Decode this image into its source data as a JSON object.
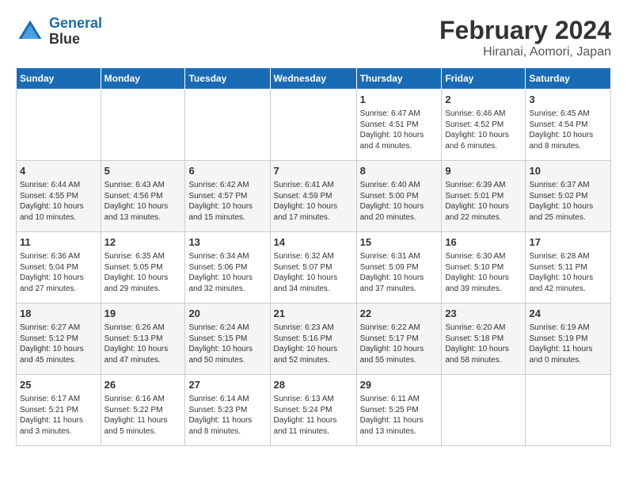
{
  "header": {
    "logo_line1": "General",
    "logo_line2": "Blue",
    "title": "February 2024",
    "subtitle": "Hiranai, Aomori, Japan"
  },
  "columns": [
    "Sunday",
    "Monday",
    "Tuesday",
    "Wednesday",
    "Thursday",
    "Friday",
    "Saturday"
  ],
  "rows": [
    [
      {
        "empty": true
      },
      {
        "empty": true
      },
      {
        "empty": true
      },
      {
        "empty": true
      },
      {
        "day": "1",
        "info": "Sunrise: 6:47 AM\nSunset: 4:51 PM\nDaylight: 10 hours\nand 4 minutes."
      },
      {
        "day": "2",
        "info": "Sunrise: 6:46 AM\nSunset: 4:52 PM\nDaylight: 10 hours\nand 6 minutes."
      },
      {
        "day": "3",
        "info": "Sunrise: 6:45 AM\nSunset: 4:54 PM\nDaylight: 10 hours\nand 8 minutes."
      }
    ],
    [
      {
        "day": "4",
        "info": "Sunrise: 6:44 AM\nSunset: 4:55 PM\nDaylight: 10 hours\nand 10 minutes."
      },
      {
        "day": "5",
        "info": "Sunrise: 6:43 AM\nSunset: 4:56 PM\nDaylight: 10 hours\nand 13 minutes."
      },
      {
        "day": "6",
        "info": "Sunrise: 6:42 AM\nSunset: 4:57 PM\nDaylight: 10 hours\nand 15 minutes."
      },
      {
        "day": "7",
        "info": "Sunrise: 6:41 AM\nSunset: 4:59 PM\nDaylight: 10 hours\nand 17 minutes."
      },
      {
        "day": "8",
        "info": "Sunrise: 6:40 AM\nSunset: 5:00 PM\nDaylight: 10 hours\nand 20 minutes."
      },
      {
        "day": "9",
        "info": "Sunrise: 6:39 AM\nSunset: 5:01 PM\nDaylight: 10 hours\nand 22 minutes."
      },
      {
        "day": "10",
        "info": "Sunrise: 6:37 AM\nSunset: 5:02 PM\nDaylight: 10 hours\nand 25 minutes."
      }
    ],
    [
      {
        "day": "11",
        "info": "Sunrise: 6:36 AM\nSunset: 5:04 PM\nDaylight: 10 hours\nand 27 minutes."
      },
      {
        "day": "12",
        "info": "Sunrise: 6:35 AM\nSunset: 5:05 PM\nDaylight: 10 hours\nand 29 minutes."
      },
      {
        "day": "13",
        "info": "Sunrise: 6:34 AM\nSunset: 5:06 PM\nDaylight: 10 hours\nand 32 minutes."
      },
      {
        "day": "14",
        "info": "Sunrise: 6:32 AM\nSunset: 5:07 PM\nDaylight: 10 hours\nand 34 minutes."
      },
      {
        "day": "15",
        "info": "Sunrise: 6:31 AM\nSunset: 5:09 PM\nDaylight: 10 hours\nand 37 minutes."
      },
      {
        "day": "16",
        "info": "Sunrise: 6:30 AM\nSunset: 5:10 PM\nDaylight: 10 hours\nand 39 minutes."
      },
      {
        "day": "17",
        "info": "Sunrise: 6:28 AM\nSunset: 5:11 PM\nDaylight: 10 hours\nand 42 minutes."
      }
    ],
    [
      {
        "day": "18",
        "info": "Sunrise: 6:27 AM\nSunset: 5:12 PM\nDaylight: 10 hours\nand 45 minutes."
      },
      {
        "day": "19",
        "info": "Sunrise: 6:26 AM\nSunset: 5:13 PM\nDaylight: 10 hours\nand 47 minutes."
      },
      {
        "day": "20",
        "info": "Sunrise: 6:24 AM\nSunset: 5:15 PM\nDaylight: 10 hours\nand 50 minutes."
      },
      {
        "day": "21",
        "info": "Sunrise: 6:23 AM\nSunset: 5:16 PM\nDaylight: 10 hours\nand 52 minutes."
      },
      {
        "day": "22",
        "info": "Sunrise: 6:22 AM\nSunset: 5:17 PM\nDaylight: 10 hours\nand 55 minutes."
      },
      {
        "day": "23",
        "info": "Sunrise: 6:20 AM\nSunset: 5:18 PM\nDaylight: 10 hours\nand 58 minutes."
      },
      {
        "day": "24",
        "info": "Sunrise: 6:19 AM\nSunset: 5:19 PM\nDaylight: 11 hours\nand 0 minutes."
      }
    ],
    [
      {
        "day": "25",
        "info": "Sunrise: 6:17 AM\nSunset: 5:21 PM\nDaylight: 11 hours\nand 3 minutes."
      },
      {
        "day": "26",
        "info": "Sunrise: 6:16 AM\nSunset: 5:22 PM\nDaylight: 11 hours\nand 5 minutes."
      },
      {
        "day": "27",
        "info": "Sunrise: 6:14 AM\nSunset: 5:23 PM\nDaylight: 11 hours\nand 8 minutes."
      },
      {
        "day": "28",
        "info": "Sunrise: 6:13 AM\nSunset: 5:24 PM\nDaylight: 11 hours\nand 11 minutes."
      },
      {
        "day": "29",
        "info": "Sunrise: 6:11 AM\nSunset: 5:25 PM\nDaylight: 11 hours\nand 13 minutes."
      },
      {
        "empty": true
      },
      {
        "empty": true
      }
    ]
  ]
}
